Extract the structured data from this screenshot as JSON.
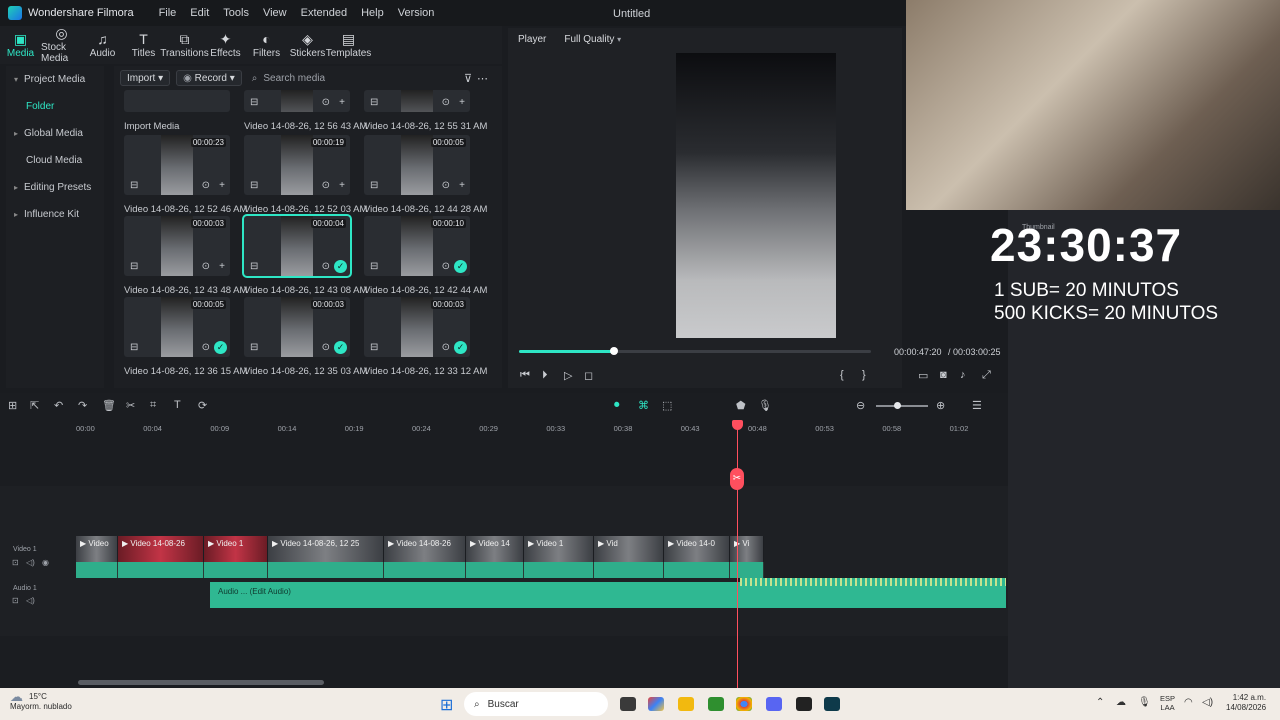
{
  "app": {
    "name": "Wondershare Filmora",
    "doc_title": "Untitled",
    "menu": [
      "File",
      "Edit",
      "Tools",
      "View",
      "Extended",
      "Help",
      "Version"
    ]
  },
  "toolbar": [
    {
      "label": "Media",
      "icon": "media-icon",
      "active": true
    },
    {
      "label": "Stock Media",
      "icon": "stock-media-icon"
    },
    {
      "label": "Audio",
      "icon": "audio-icon"
    },
    {
      "label": "Titles",
      "icon": "titles-icon"
    },
    {
      "label": "Transitions",
      "icon": "transitions-icon"
    },
    {
      "label": "Effects",
      "icon": "effects-icon"
    },
    {
      "label": "Filters",
      "icon": "filters-icon"
    },
    {
      "label": "Stickers",
      "icon": "stickers-icon"
    },
    {
      "label": "Templates",
      "icon": "templates-icon"
    }
  ],
  "sidebar": {
    "items": [
      {
        "label": "Project Media",
        "caret": "▾"
      },
      {
        "label": "Folder",
        "selected": true
      },
      {
        "label": "Global Media",
        "caret": "▸"
      },
      {
        "label": "Cloud Media"
      },
      {
        "label": "Editing Presets",
        "caret": "▸"
      },
      {
        "label": "Influence Kit",
        "caret": "▸"
      }
    ]
  },
  "media_bar": {
    "import_label": "Import",
    "record_label": "Record",
    "search_placeholder": "Search media"
  },
  "media": [
    {
      "caption": "Import Media",
      "duration": ""
    },
    {
      "caption": "Video 14-08-26, 12 56 43 AM",
      "duration": ""
    },
    {
      "caption": "Video 14-08-26, 12 55 31 AM",
      "duration": ""
    },
    {
      "caption": "Video 14-08-26, 12 52 46 AM",
      "duration": "00:00:23"
    },
    {
      "caption": "Video 14-08-26, 12 52 03 AM",
      "duration": "00:00:19"
    },
    {
      "caption": "Video 14-08-26, 12 44 28 AM",
      "duration": "00:00:05"
    },
    {
      "caption": "Video 14-08-26, 12 43 48 AM",
      "duration": "00:00:03"
    },
    {
      "caption": "Video 14-08-26, 12 43 08 AM",
      "duration": "00:00:04",
      "selected": true,
      "used": true
    },
    {
      "caption": "Video 14-08-26, 12 42 44 AM",
      "duration": "00:00:10",
      "used": true
    },
    {
      "caption": "Video 14-08-26, 12 36 15 AM",
      "duration": "00:00:05",
      "used": true
    },
    {
      "caption": "Video 14-08-26, 12 35 03 AM",
      "duration": "00:00:03",
      "used": true
    },
    {
      "caption": "Video 14-08-26, 12 33 12 AM",
      "duration": "00:00:03",
      "used": true
    }
  ],
  "player": {
    "tab": "Player",
    "quality": "Full Quality",
    "current_time": "00:00:47:20",
    "total_time": "/ 00:03:00:25",
    "progress": 0.27
  },
  "timeline": {
    "ruler": [
      "00:00",
      "00:04",
      "00:09",
      "00:14",
      "00:19",
      "00:24",
      "00:29",
      "00:33",
      "00:38",
      "00:43",
      "00:48",
      "00:53",
      "00:58",
      "01:02"
    ],
    "tracks": {
      "video": "Video 1",
      "audio": "Audio 1"
    },
    "clip_labels": [
      "Video",
      "Video 14-08-26",
      "Video 1",
      "Video 14-08-26, 12 25",
      "Video 14-08-26",
      "Video 14",
      "Video 1",
      "Vid",
      "Video 14-0",
      "Vi"
    ],
    "audio_label": "Audio ... (Edit Audio)"
  },
  "overlay": {
    "timer": "23:30:37",
    "line1": "1 SUB= 20 MINUTOS",
    "line2": "500 KICKS= 20 MINUTOS",
    "small_label": "Thumbnail"
  },
  "taskbar": {
    "temp": "15°C",
    "weather": "Mayorm. nublado",
    "search": "Buscar",
    "lang1": "ESP",
    "lang2": "LAA",
    "time": "1:42 a.m.",
    "date": "14/08/2026"
  },
  "colors": {
    "accent": "#2ee6c5",
    "playhead": "#ff4f5e",
    "audio": "#2fb892"
  }
}
